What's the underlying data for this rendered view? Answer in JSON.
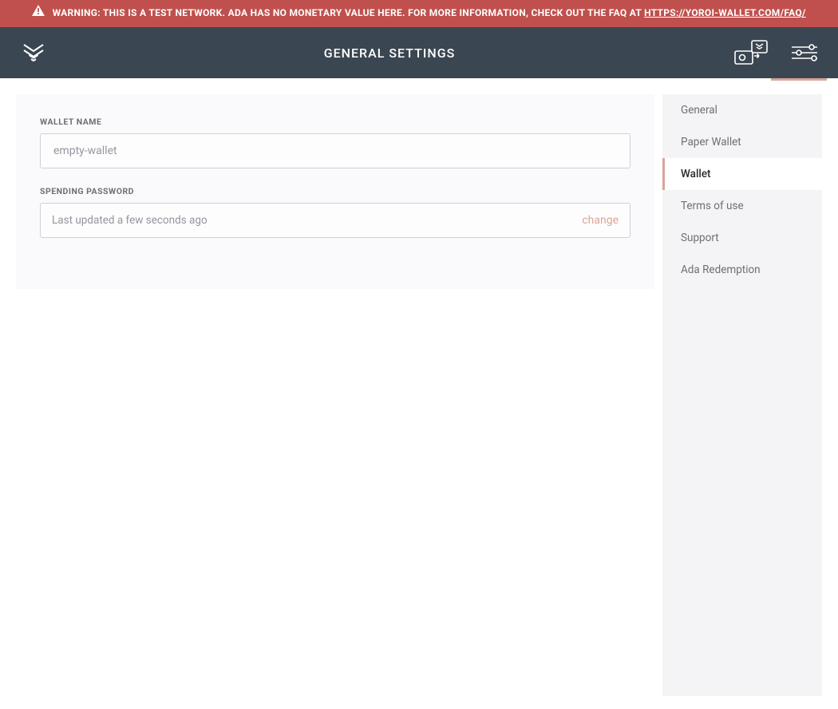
{
  "banner": {
    "text": "WARNING: THIS IS A TEST NETWORK. ADA HAS NO MONETARY VALUE HERE. FOR MORE INFORMATION, CHECK OUT THE FAQ AT ",
    "link_text": "HTTPS://YOROI-WALLET.COM/FAQ/"
  },
  "header": {
    "title": "GENERAL SETTINGS"
  },
  "panel": {
    "wallet_name_label": "WALLET NAME",
    "wallet_name_value": "empty-wallet",
    "spending_password_label": "SPENDING PASSWORD",
    "spending_password_status": "Last updated a few seconds ago",
    "change_label": "change"
  },
  "sidebar": {
    "items": [
      {
        "label": "General",
        "active": false
      },
      {
        "label": "Paper Wallet",
        "active": false
      },
      {
        "label": "Wallet",
        "active": true
      },
      {
        "label": "Terms of use",
        "active": false
      },
      {
        "label": "Support",
        "active": false
      },
      {
        "label": "Ada Redemption",
        "active": false
      }
    ]
  },
  "icons": {
    "logo": "logo-icon",
    "transfer": "wallet-transfer-icon",
    "settings": "sliders-icon",
    "warning": "warning-icon"
  }
}
